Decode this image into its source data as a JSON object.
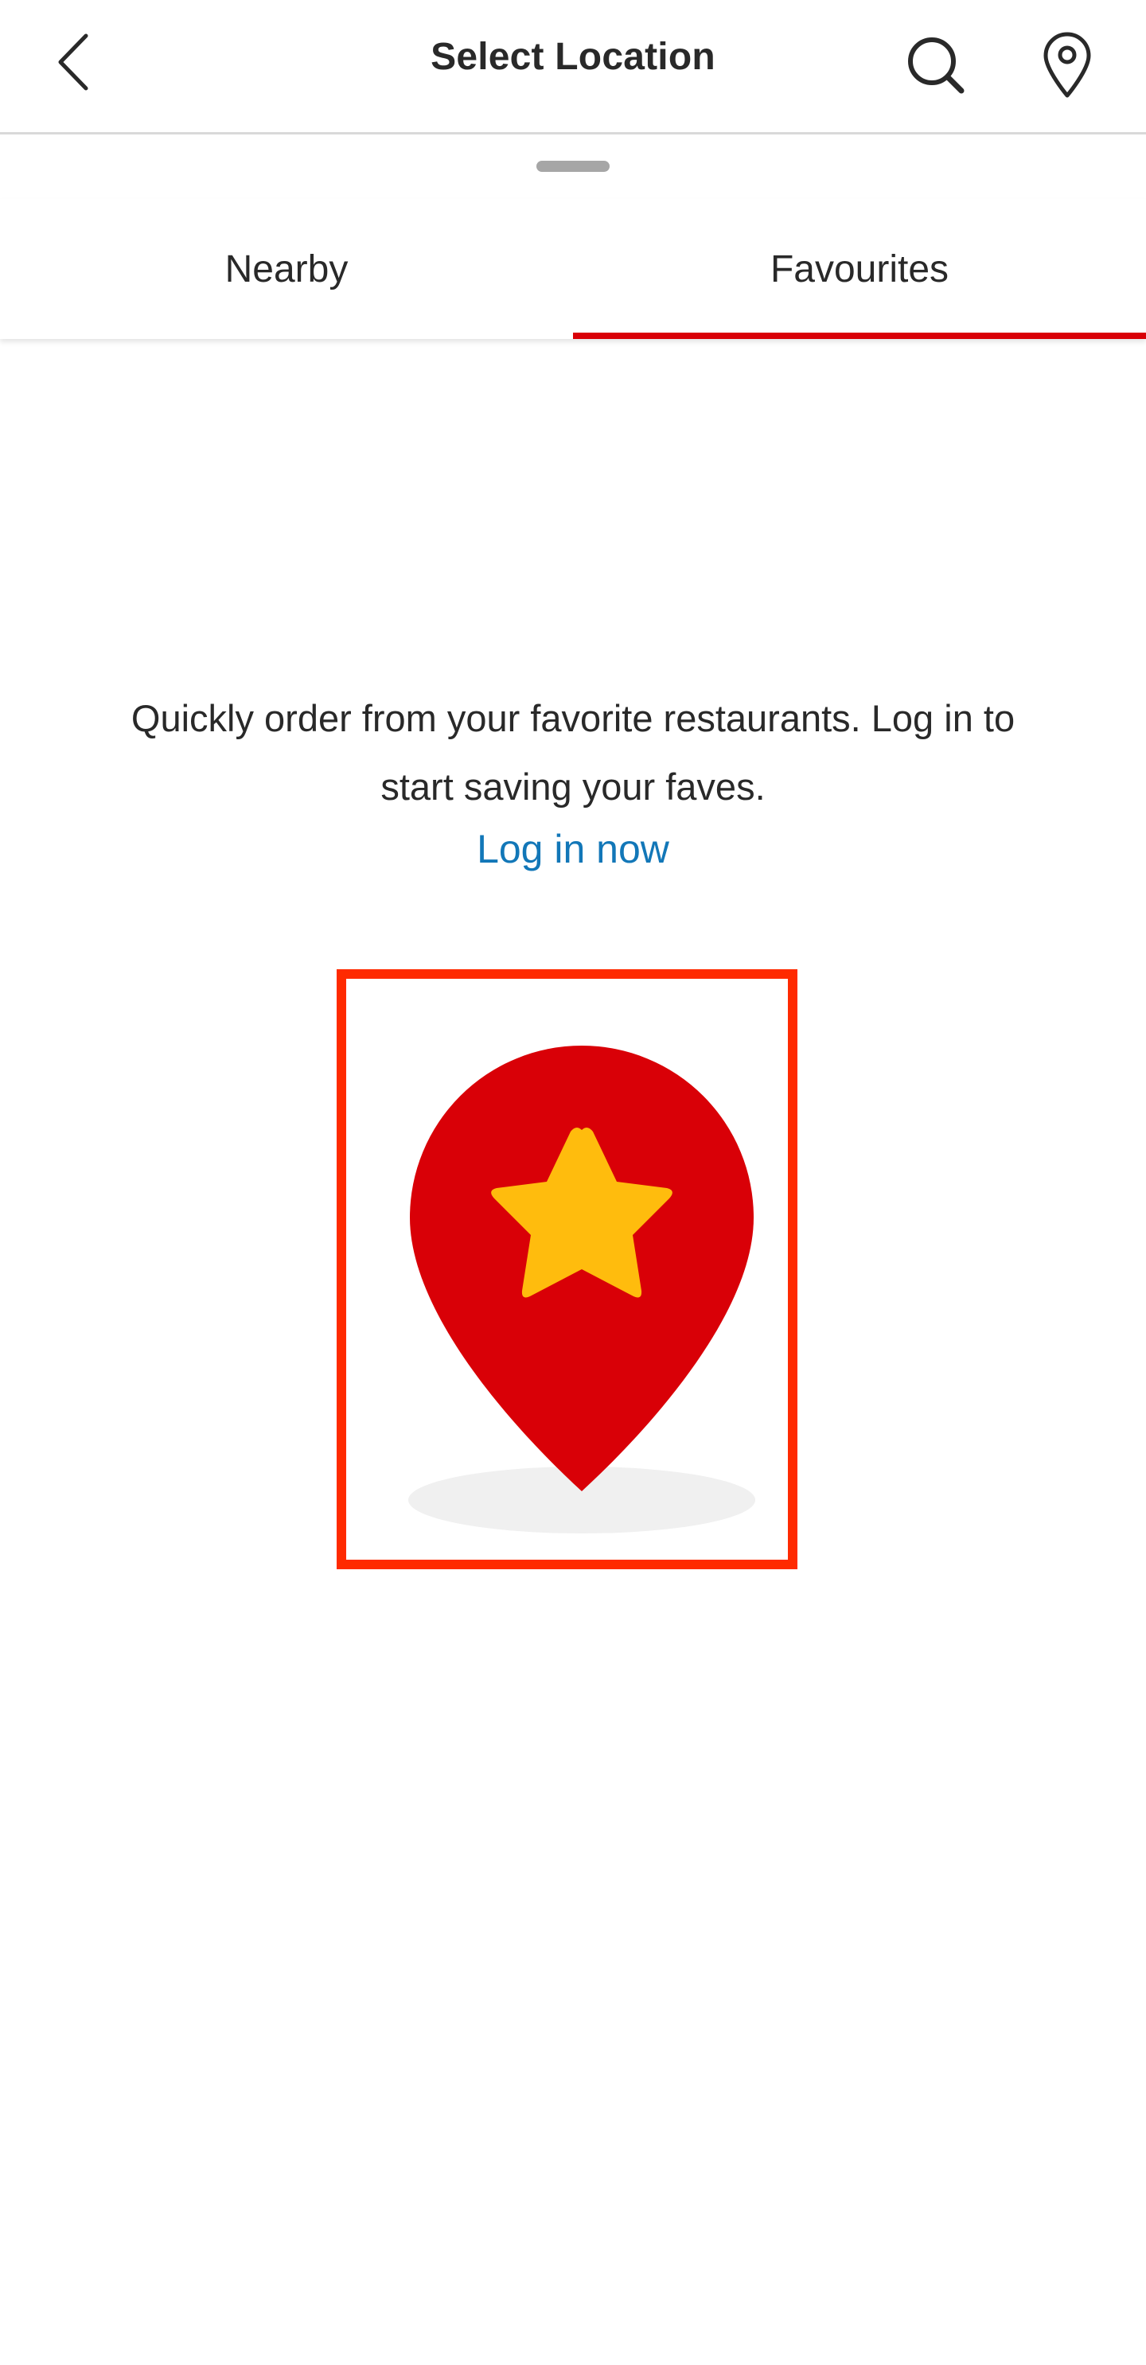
{
  "header": {
    "title": "Select Location",
    "back_icon": "chevron-left-icon",
    "search_icon": "search-icon",
    "location_icon": "map-pin-icon"
  },
  "tabs": [
    {
      "label": "Nearby",
      "active": false
    },
    {
      "label": "Favourites",
      "active": true
    }
  ],
  "empty_state": {
    "message": "Quickly order from your favorite restaurants. Log in to start saving your faves.",
    "login_link": "Log in now",
    "illustration_icon": "favorite-location-pin-icon"
  },
  "colors": {
    "accent_red": "#d90007",
    "link_blue": "#1277b8",
    "star_yellow": "#ffbc0d",
    "highlight_frame": "#ff2a00"
  }
}
